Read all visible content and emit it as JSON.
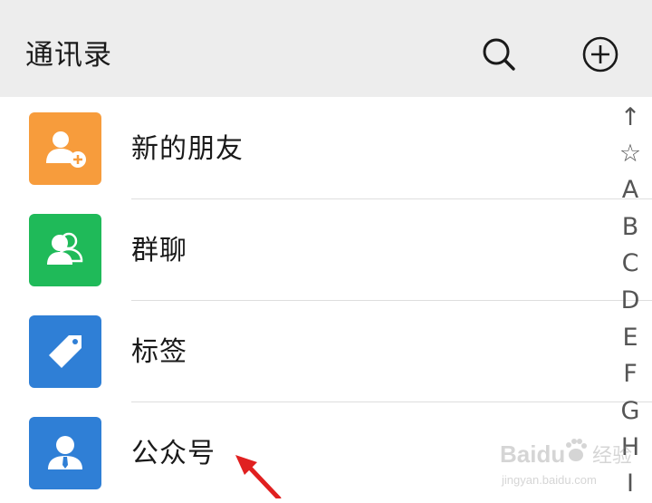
{
  "header": {
    "title": "通讯录",
    "search_icon": "search-icon",
    "add_icon": "plus-circle-icon"
  },
  "contacts": [
    {
      "label": "新的朋友",
      "icon": "add-friend-icon",
      "color": "#f79c3c"
    },
    {
      "label": "群聊",
      "icon": "group-chat-icon",
      "color": "#1fba59"
    },
    {
      "label": "标签",
      "icon": "tag-icon",
      "color": "#2f7fd6"
    },
    {
      "label": "公众号",
      "icon": "official-account-icon",
      "color": "#2f7fd6"
    }
  ],
  "index_bar": [
    "↑",
    "☆",
    "A",
    "B",
    "C",
    "D",
    "E",
    "F",
    "G",
    "H",
    "I"
  ],
  "watermark": {
    "brand": "Baidu",
    "cn": "经验",
    "url": "jingyan.baidu.com"
  },
  "colors": {
    "header_bg": "#ededed",
    "annotation_arrow": "#e02020"
  }
}
